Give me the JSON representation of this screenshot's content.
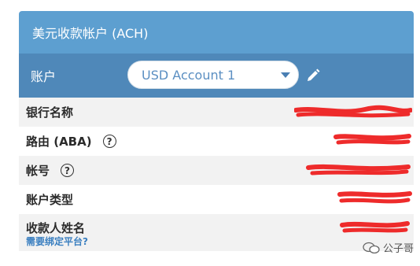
{
  "header": {
    "title": "美元收款帐户 (ACH)"
  },
  "account": {
    "label": "账户",
    "selected": "USD Account 1",
    "edit_icon": "pencil-icon"
  },
  "rows": [
    {
      "label": "银行名称"
    },
    {
      "label": "路由 (ABA)",
      "help_icon": "question-circle-icon"
    },
    {
      "label": "帐号",
      "help_icon": "question-circle-icon"
    },
    {
      "label": "账户类型"
    },
    {
      "label": "收款人姓名",
      "link": "需要绑定平台?"
    }
  ],
  "watermark": {
    "text": "公子哥"
  },
  "colors": {
    "header_bg": "#5d9fd0",
    "account_bar_bg": "#4f88b9",
    "redaction": "#ee2b2b",
    "link": "#3a7fc0"
  }
}
